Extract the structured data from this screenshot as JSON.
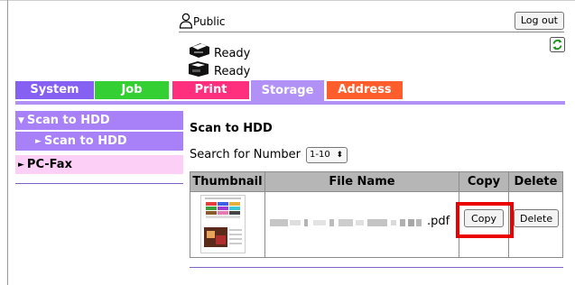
{
  "user": {
    "name": "Public",
    "icon": "user-icon"
  },
  "header": {
    "logout_label": "Log out",
    "refresh_icon": "refresh-icon"
  },
  "status": [
    {
      "icon": "printer-icon",
      "text": "Ready"
    },
    {
      "icon": "scanner-icon",
      "text": "Ready"
    }
  ],
  "tabs": {
    "system": "System",
    "job": "Job",
    "print": "Print",
    "storage": "Storage",
    "address": "Address",
    "active": "Storage"
  },
  "tab_colors": {
    "system": "#8560f2",
    "job": "#33cf33",
    "print": "#ff2f7d",
    "storage": "#b191f6",
    "address": "#ff5d2b"
  },
  "sidebar": {
    "items": [
      {
        "label": "Scan to HDD",
        "arrow": "▼"
      },
      {
        "label": "Scan to HDD",
        "arrow": "►"
      },
      {
        "label": "PC-Fax",
        "arrow": "►"
      }
    ]
  },
  "main": {
    "title": "Scan to HDD",
    "search_label": "Search for Number",
    "search_value": "1-10",
    "table": {
      "headers": [
        "Thumbnail",
        "File Name",
        "Copy",
        "Delete"
      ],
      "rows": [
        {
          "file_ext": ".pdf",
          "copy_label": "Copy",
          "delete_label": "Delete"
        }
      ]
    }
  },
  "highlight_color": "#ea0000"
}
